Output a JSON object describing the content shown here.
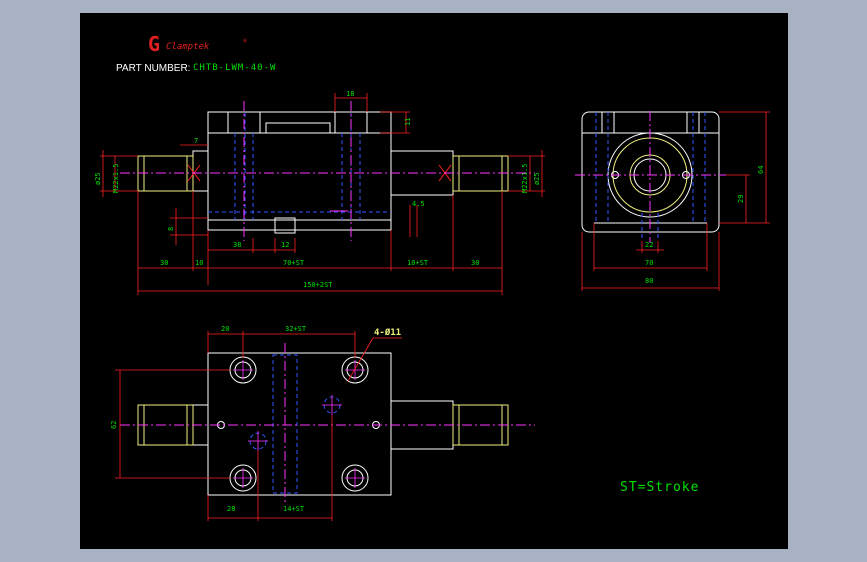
{
  "colors": {
    "background_window": "#a9b2c3",
    "canvas": "#000000",
    "outline": "#ffffff",
    "hidden": "#3355ff",
    "center": "#ff33ff",
    "dimension": "#ff2020",
    "dim_text": "#00e000",
    "thread": "#f0f080",
    "logo": "#e02020"
  },
  "logo": {
    "brand_text": "Clamptek",
    "mark": "G",
    "registered": "®"
  },
  "title": {
    "label": "PART NUMBER:",
    "value": "CHTB-LWM-40-W"
  },
  "dims": {
    "d18": "18",
    "d11": "11",
    "d7": "7",
    "dia25_left": "ø25",
    "thread_left": "M22x1.5",
    "thread_right": "M22x1.5",
    "dia25_right": "ø25",
    "d45": "4.5",
    "d8": "8",
    "d38": "38",
    "d12": "12",
    "d30_left": "30",
    "d10": "10",
    "d70st": "70+ST",
    "d10st": "10+ST",
    "d30_right": "30",
    "d150": "150+2ST",
    "d64": "64",
    "d29": "29",
    "d22": "22",
    "d70": "70",
    "d80": "80",
    "d20": "20",
    "d32st": "32+ST",
    "holes": "4-Ø11",
    "d62": "62",
    "d28": "28",
    "d14st": "14+ST"
  },
  "note": "ST=Stroke"
}
